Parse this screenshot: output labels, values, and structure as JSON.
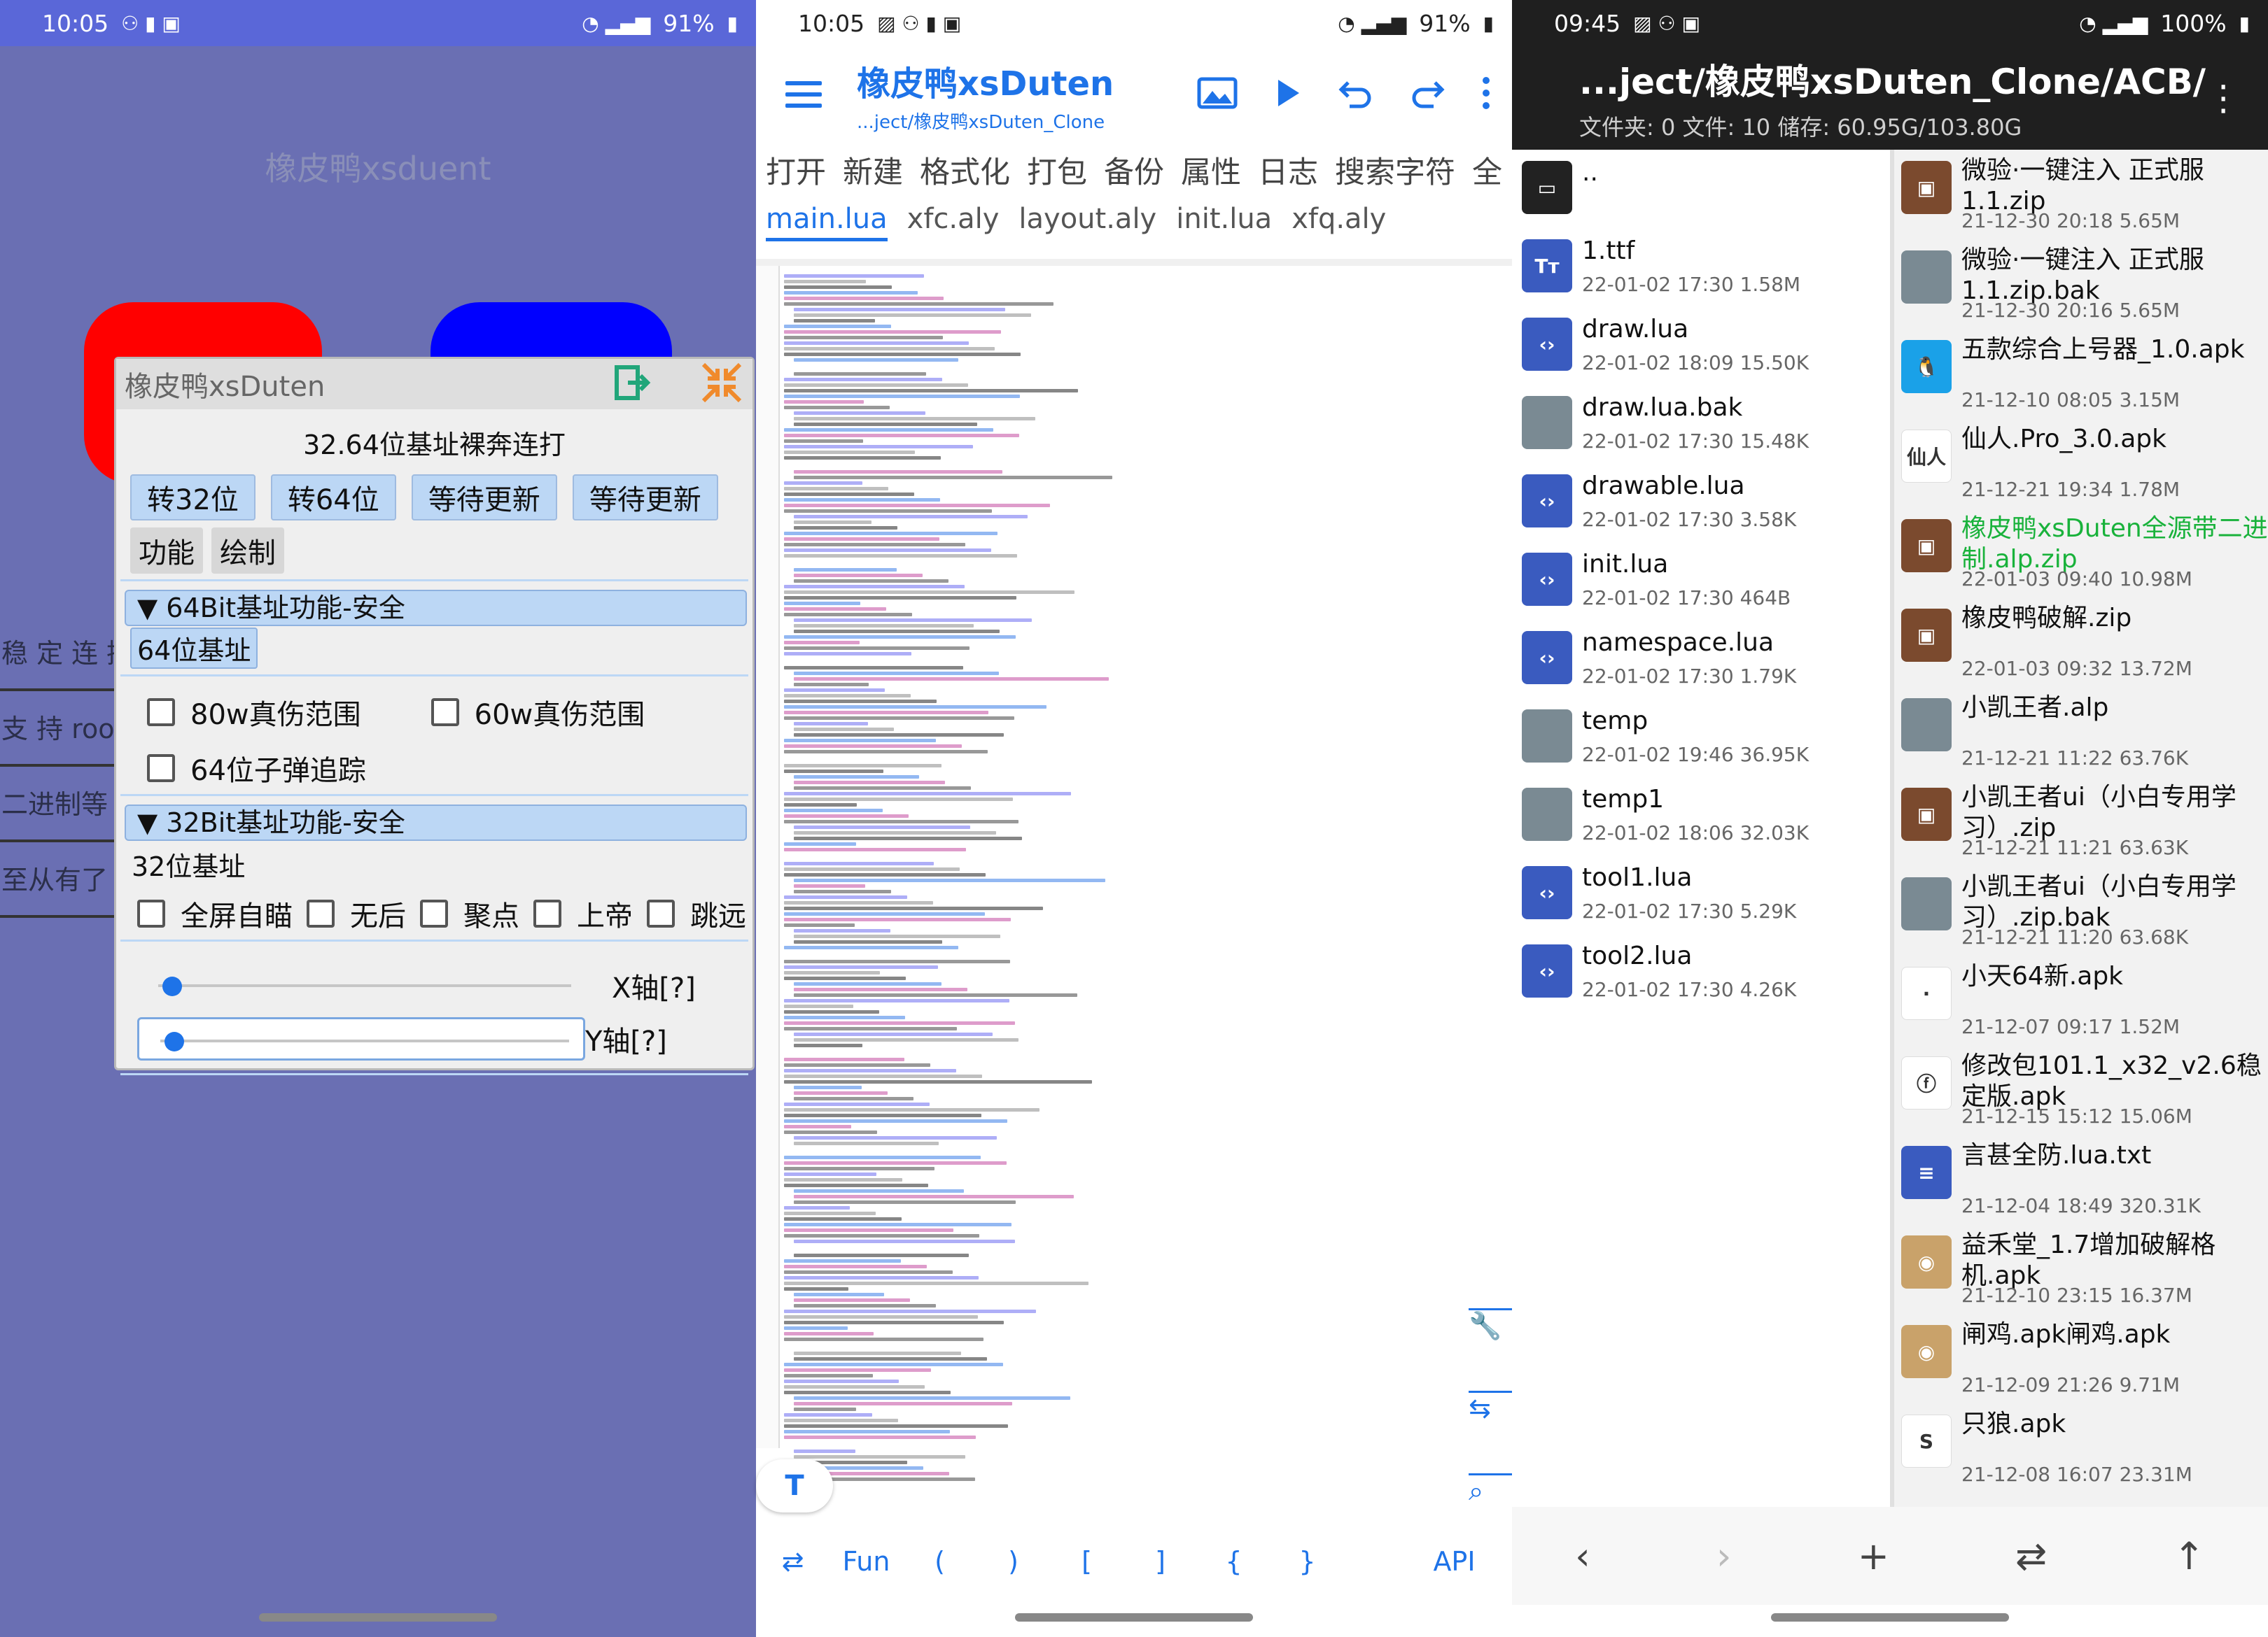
{
  "colors": {
    "accent": "#1e73e8",
    "panel1_bg": "#6a6fb3",
    "folder_blue": "#3a5bbf",
    "file_gray": "#7a8a93",
    "archive_brown": "#7b4a2e",
    "green_name": "#19b23b"
  },
  "panel1": {
    "status": {
      "time": "10:05",
      "battery": "91%"
    },
    "title": "橡皮鸭xsduent",
    "side_items": [
      "稳 定 连 接",
      "支 持 root",
      "二进制等",
      "至从有了"
    ],
    "window": {
      "title": "橡皮鸭xsDuten",
      "line1": "32.64位基址裸奔连打",
      "buttons": [
        "转32位",
        "转64位",
        "等待更新",
        "等待更新"
      ],
      "tabs": [
        "功能",
        "绘制"
      ],
      "section64": "▼  64Bit基址功能-安全",
      "sub64": "64位基址",
      "cb64": [
        "80w真伤范围",
        "60w真伤范围",
        "64位子弹追踪"
      ],
      "section32": "▼  32Bit基址功能-安全",
      "sub32": "32位基址",
      "cb32": [
        "全屏自瞄",
        "无后",
        "聚点",
        "上帝",
        "跳远"
      ],
      "slider_x": "X轴[?]",
      "slider_y": "Y轴[?]"
    }
  },
  "panel2": {
    "status": {
      "time": "10:05",
      "battery": "91%"
    },
    "title": "橡皮鸭xsDuten",
    "subtitle": "...ject/橡皮鸭xsDuten_Clone",
    "menu": [
      "打开",
      "新建",
      "格式化",
      "打包",
      "备份",
      "属性",
      "日志",
      "搜索字符",
      "全"
    ],
    "files": [
      "main.lua",
      "xfc.aly",
      "layout.aly",
      "init.lua",
      "xfq.aly"
    ],
    "bottom": [
      "⇄",
      "Fun",
      "(",
      ")",
      "[",
      "]",
      "{",
      "}",
      "",
      "API"
    ],
    "fab_label": "T"
  },
  "panel3": {
    "status": {
      "time": "09:45",
      "battery": "100%"
    },
    "title": "...ject/橡皮鸭xsDuten_Clone/ACB/",
    "info": "文件夹: 0  文件: 10  储存: 60.95G/103.80G",
    "left_files": [
      {
        "name": "..",
        "meta": "",
        "icon": "folder"
      },
      {
        "name": "1.ttf",
        "meta": "22-01-02 17:30  1.58M",
        "icon": "font"
      },
      {
        "name": "draw.lua",
        "meta": "22-01-02 18:09  15.50K",
        "icon": "code"
      },
      {
        "name": "draw.lua.bak",
        "meta": "22-01-02 17:30  15.48K",
        "icon": "doc"
      },
      {
        "name": "drawable.lua",
        "meta": "22-01-02 17:30  3.58K",
        "icon": "code"
      },
      {
        "name": "init.lua",
        "meta": "22-01-02 17:30  464B",
        "icon": "code"
      },
      {
        "name": "namespace.lua",
        "meta": "22-01-02 17:30  1.79K",
        "icon": "code"
      },
      {
        "name": "temp",
        "meta": "22-01-02 19:46  36.95K",
        "icon": "doc"
      },
      {
        "name": "temp1",
        "meta": "22-01-02 18:06  32.03K",
        "icon": "doc"
      },
      {
        "name": "tool1.lua",
        "meta": "22-01-02 17:30  5.29K",
        "icon": "code"
      },
      {
        "name": "tool2.lua",
        "meta": "22-01-02 17:30  4.26K",
        "icon": "code"
      }
    ],
    "right_files": [
      {
        "name": "微验·一键注入 正式服 1.1.zip",
        "meta": "21-12-30 20:18  5.65M",
        "icon": "archive"
      },
      {
        "name": "微验·一键注入 正式服 1.1.zip.bak",
        "meta": "21-12-30 20:16  5.65M",
        "icon": "doc"
      },
      {
        "name": "五款综合上号器_1.0.apk",
        "meta": "21-12-10 08:05  3.15M",
        "icon": "apk-penguin"
      },
      {
        "name": "仙人.Pro_3.0.apk",
        "meta": "21-12-21 19:34  1.78M",
        "icon": "apk-xianren"
      },
      {
        "name": "橡皮鸭xsDuten全源带二进制.alp.zip",
        "meta": "22-01-03 09:40  10.98M",
        "icon": "archive"
      },
      {
        "name": "橡皮鸭破解.zip",
        "meta": "22-01-03 09:32  13.72M",
        "icon": "archive"
      },
      {
        "name": "小凯王者.alp",
        "meta": "21-12-21 11:22  63.76K",
        "icon": "doc"
      },
      {
        "name": "小凯王者ui（小白专用学习）.zip",
        "meta": "21-12-21 11:21  63.63K",
        "icon": "archive"
      },
      {
        "name": "小凯王者ui（小白专用学习）.zip.bak",
        "meta": "21-12-21 11:20  63.68K",
        "icon": "doc"
      },
      {
        "name": "小天64新.apk",
        "meta": "21-12-07 09:17  1.52M",
        "icon": "apk-white"
      },
      {
        "name": "修改包101.1_x32_v2.6稳定版.apk",
        "meta": "21-12-15 15:12  15.06M",
        "icon": "apk-f"
      },
      {
        "name": "言甚全防.lua.txt",
        "meta": "21-12-04 18:49  320.31K",
        "icon": "text"
      },
      {
        "name": "益禾堂_1.7增加破解格机.apk",
        "meta": "21-12-10 23:15  16.37M",
        "icon": "apk-dog"
      },
      {
        "name": "闸鸡.apk闸鸡.apk",
        "meta": "21-12-09 21:26  9.71M",
        "icon": "apk-dog"
      },
      {
        "name": "只狼.apk",
        "meta": "21-12-08 16:07  23.31M",
        "icon": "apk-s"
      }
    ],
    "bottom": [
      "‹",
      "›",
      "+",
      "⇄",
      "↑"
    ]
  }
}
